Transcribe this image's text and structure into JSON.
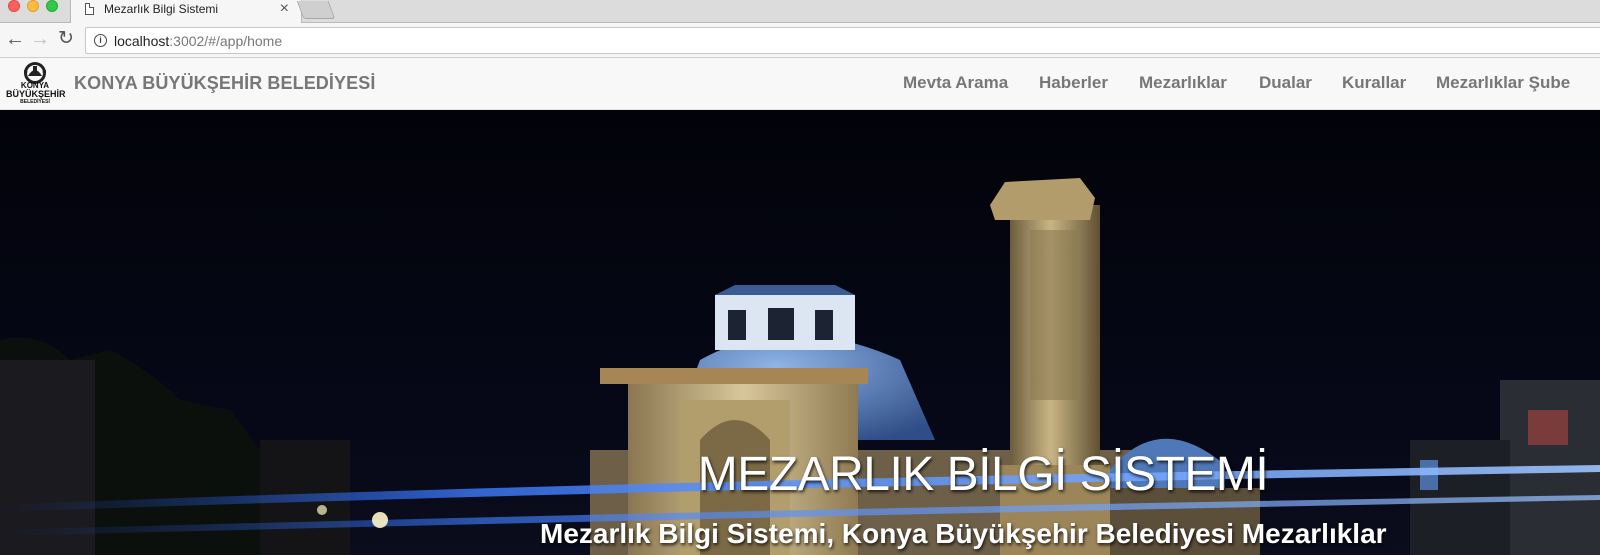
{
  "browser": {
    "tab_title": "Mezarlık Bilgi Sistemi",
    "tab_close": "×",
    "url_host": "localhost",
    "url_rest": ":3002/#/app/home",
    "back_icon": "←",
    "forward_icon": "→",
    "reload_icon": "↻",
    "info_icon": "i"
  },
  "logo": {
    "line1": "KONYA",
    "line2": "BÜYÜKŞEHİR",
    "line3": "BELEDİYESİ"
  },
  "navbar": {
    "brand": "KONYA BÜYÜKŞEHİR BELEDİYESİ",
    "items": [
      {
        "label": "Mevta Arama"
      },
      {
        "label": "Haberler"
      },
      {
        "label": "Mezarlıklar"
      },
      {
        "label": "Dualar"
      },
      {
        "label": "Kurallar"
      },
      {
        "label": "Mezarlıklar Şube"
      }
    ]
  },
  "hero": {
    "title": "MEZARLIK BİLGİ SİSTEMİ",
    "subtitle": "Mezarlık Bilgi Sistemi, Konya Büyükşehir Belediyesi Mezarlıklar"
  },
  "colors": {
    "navbar_bg": "#f8f8f8",
    "nav_text": "#777777",
    "hero_sky": "#04050d",
    "dome_blue": "#5f89c6"
  }
}
